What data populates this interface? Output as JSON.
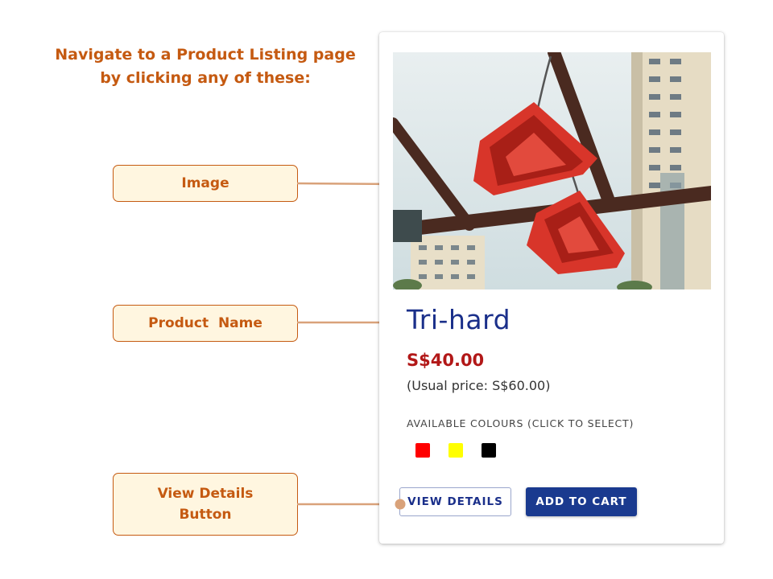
{
  "instruction": {
    "line1": "Navigate to a Product Listing page",
    "line2": "by clicking any of these:"
  },
  "callouts": {
    "image": "Image",
    "product_name": "Product  Name",
    "view_details_line1": "View Details",
    "view_details_line2": "Button"
  },
  "product": {
    "name": "Tri-hard",
    "price": "S$40.00",
    "usual_price": "(Usual price: S$60.00)",
    "colours_label": "AVAILABLE COLOURS (CLICK TO SELECT)",
    "colours": [
      "#ff0000",
      "#ffff00",
      "#000000"
    ],
    "image_icon": "red-triangle-climbing-holds-photo"
  },
  "buttons": {
    "view_details": "VIEW DETAILS",
    "add_to_cart": "ADD TO CART"
  },
  "colors": {
    "accent_orange": "#c55a11",
    "callout_fill": "#fff6e0",
    "connector": "#d9a27a",
    "brand_blue": "#1a3a8f",
    "price_red": "#b21818"
  }
}
